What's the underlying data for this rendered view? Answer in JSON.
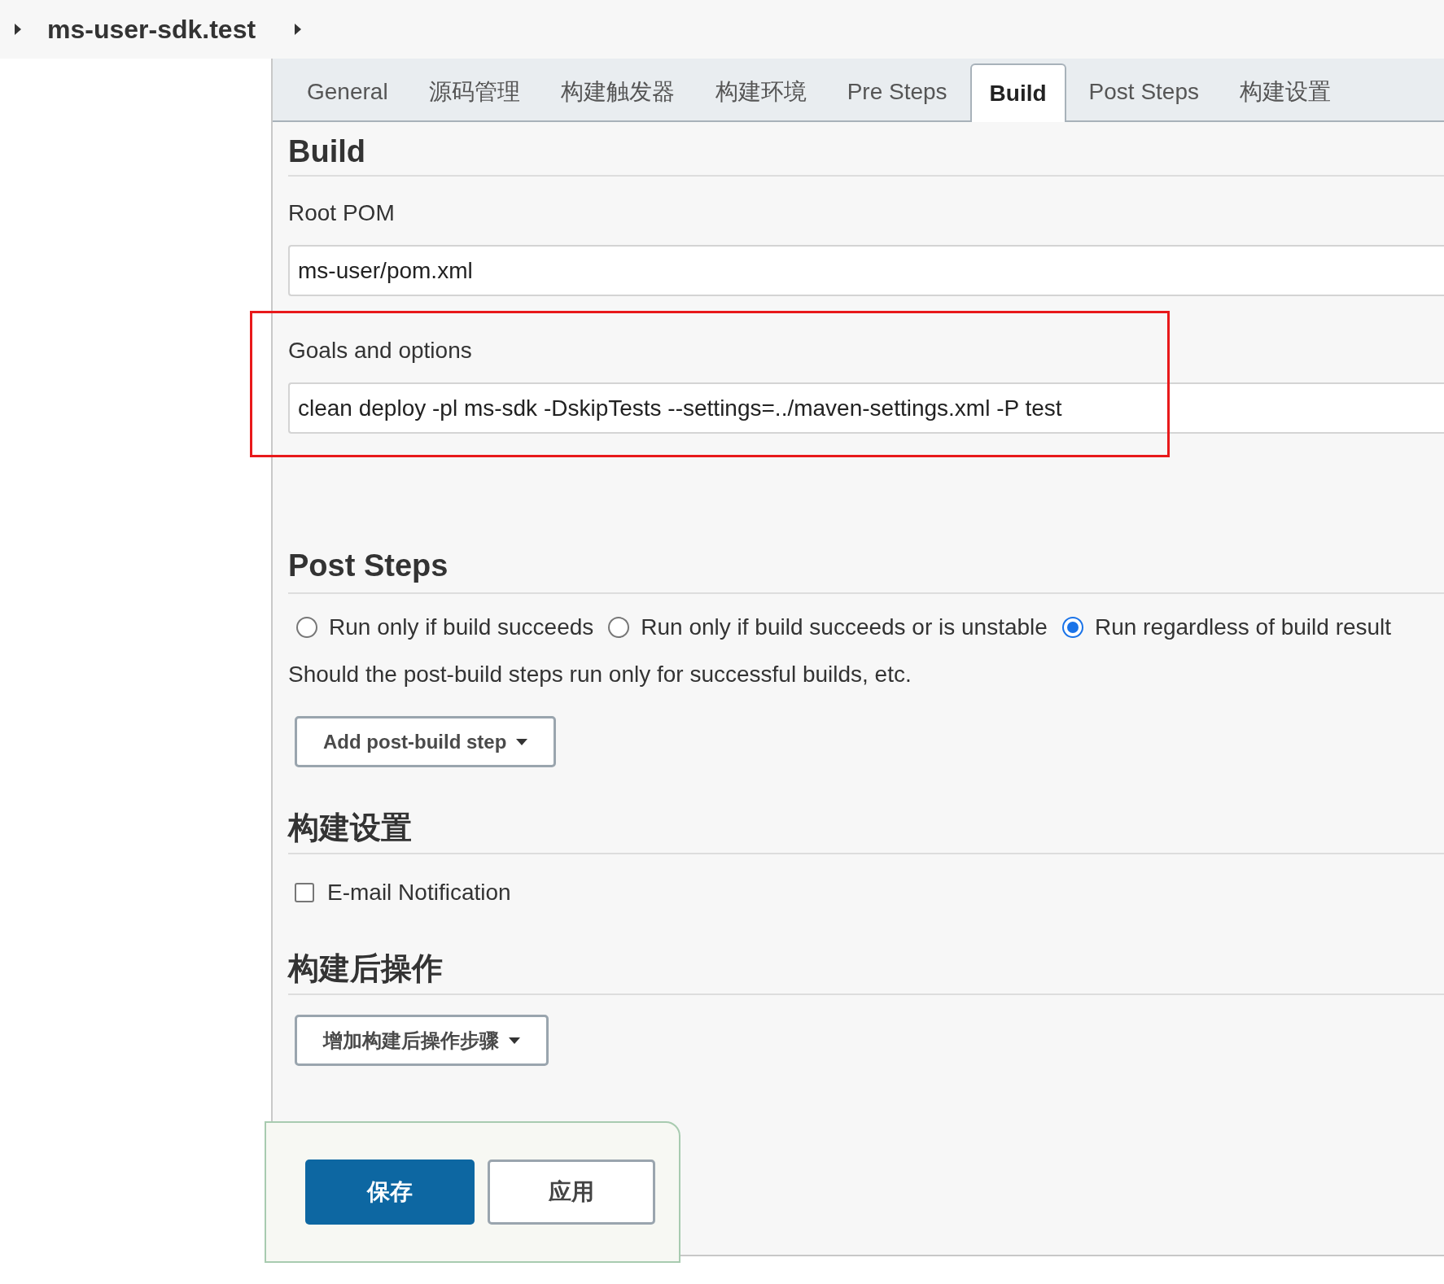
{
  "breadcrumb": {
    "title": "ms-user-sdk.test"
  },
  "tabs": [
    {
      "label": "General",
      "selected": false
    },
    {
      "label": "源码管理",
      "selected": false
    },
    {
      "label": "构建触发器",
      "selected": false
    },
    {
      "label": "构建环境",
      "selected": false
    },
    {
      "label": "Pre Steps",
      "selected": false
    },
    {
      "label": "Build",
      "selected": true
    },
    {
      "label": "Post Steps",
      "selected": false
    },
    {
      "label": "构建设置",
      "selected": false
    }
  ],
  "build": {
    "heading": "Build",
    "root_pom": {
      "label": "Root POM",
      "value": "ms-user/pom.xml"
    },
    "goals": {
      "label": "Goals and options",
      "value": "clean deploy -pl ms-sdk -DskipTests --settings=../maven-settings.xml -P test",
      "highlighted": true
    }
  },
  "post_steps": {
    "heading": "Post Steps",
    "options": [
      {
        "label": "Run only if build succeeds",
        "selected": false
      },
      {
        "label": "Run only if build succeeds or is unstable",
        "selected": false
      },
      {
        "label": "Run regardless of build result",
        "selected": true
      }
    ],
    "help": "Should the post-build steps run only for successful builds, etc.",
    "button": "Add post-build step"
  },
  "build_settings": {
    "heading": "构建设置",
    "email": {
      "label": "E-mail Notification",
      "checked": false
    }
  },
  "post_build": {
    "heading": "构建后操作",
    "button": "增加构建后操作步骤"
  },
  "actions": {
    "save": "保存",
    "apply": "应用"
  }
}
